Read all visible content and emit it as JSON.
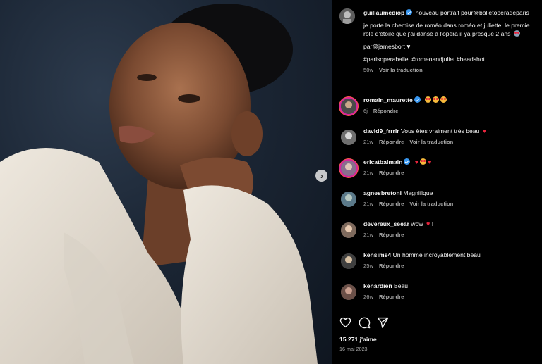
{
  "post": {
    "author": "guillaumédiop",
    "caption_line1": "nouveau portrait pour@balletoperadeparis",
    "caption_line2": "je porte la chemise de roméo dans roméo et juliette, le premie",
    "caption_line3": "rôle d'étoile que j'ai dansé à l'opéra il ya presque 2 ans",
    "credit": "par@jamesbort",
    "hashtags": "#parisoperaballet #romeoandjuliet #headshot",
    "age": "50w",
    "see_translation": "Voir la traduction"
  },
  "comments": [
    {
      "user": "romain_maurette",
      "text": "",
      "age": "6j",
      "reply": "Répondre",
      "translate": ""
    },
    {
      "user": "david9_frrrlr",
      "text": "Vous êtes vraiment très beau",
      "age": "21w",
      "reply": "Répondre",
      "translate": "Voir la traduction"
    },
    {
      "user": "ericatbalmain",
      "text": "",
      "age": "21w",
      "reply": "Répondre",
      "translate": ""
    },
    {
      "user": "agnesbretoni",
      "text": "Magnifique",
      "age": "21w",
      "reply": "Répondre",
      "translate": "Voir la traduction"
    },
    {
      "user": "devereux_seear",
      "text": "wow",
      "text_suffix": "!",
      "age": "21w",
      "reply": "Répondre",
      "translate": ""
    },
    {
      "user": "kensims4",
      "text": "Un homme incroyablement beau",
      "age": "25w",
      "reply": "Répondre",
      "translate": ""
    },
    {
      "user": "kénardien",
      "text": "Beau",
      "age": "26w",
      "reply": "Répondre",
      "translate": ""
    }
  ],
  "footer": {
    "likes": "15 271 j'aime",
    "date": "16 mai 2023"
  },
  "icons": {
    "like": "heart-outline-icon",
    "comment": "comment-bubble-icon",
    "share": "send-paper-plane-icon",
    "next": "chevron-right-icon",
    "verified": "verified-badge-icon"
  },
  "colors": {
    "background": "#000000",
    "text": "#f5f5f5",
    "muted": "#a8a8a8",
    "verified": "#3897f0",
    "heart": "#e8243c"
  }
}
